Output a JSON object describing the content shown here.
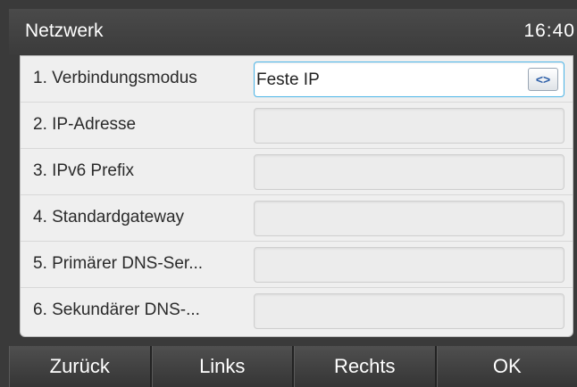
{
  "header": {
    "title": "Netzwerk",
    "clock": "16:40"
  },
  "rows": [
    {
      "label": "1. Verbindungsmodus",
      "value": "Feste IP"
    },
    {
      "label": "2. IP-Adresse",
      "value": ""
    },
    {
      "label": "3. IPv6 Prefix",
      "value": ""
    },
    {
      "label": "4. Standardgateway",
      "value": ""
    },
    {
      "label": "5. Primärer DNS-Ser...",
      "value": ""
    },
    {
      "label": "6. Sekundärer DNS-...",
      "value": ""
    }
  ],
  "toggle_icon": "left-right-arrows-icon",
  "toggle_glyph": "<>",
  "softkeys": [
    "Zurück",
    "Links",
    "Rechts",
    "OK"
  ],
  "colors": {
    "accent": "#4db6e8",
    "header_bg": "#3b3b3b",
    "panel_bg": "#efefef"
  }
}
